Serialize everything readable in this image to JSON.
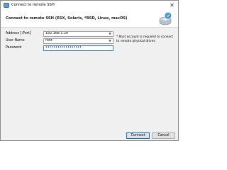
{
  "window": {
    "title": "Connect to remote SSH",
    "close_glyph": "✕"
  },
  "header": {
    "title": "Connect to remote SSH (ESX, Solaris, *BSD, Linux, macOS)",
    "icon": "network-drive-icon"
  },
  "form": {
    "address_label": "Address [:Port]",
    "address_value": "192.168.1.20",
    "username_label": "User Name",
    "username_value": "root",
    "password_label": "Password",
    "password_value": "••••••••••••••••••",
    "note": "* Root account is required to connect to remote physical drives"
  },
  "buttons": {
    "connect": "Connect",
    "cancel": "Cancel"
  },
  "colors": {
    "accent": "#0078d7",
    "focus_border": "#3c7fd0"
  }
}
